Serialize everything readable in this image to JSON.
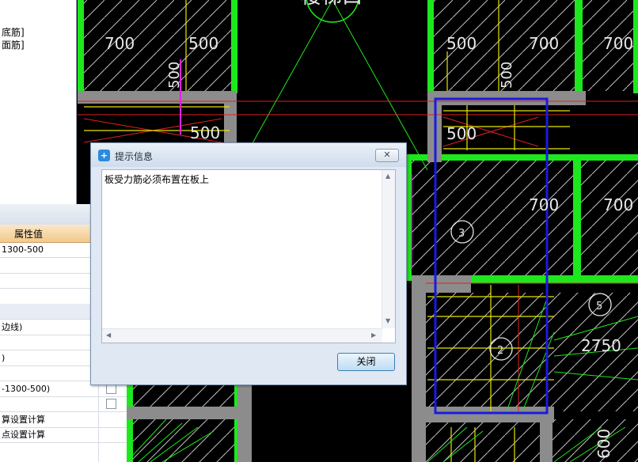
{
  "left_panel": {
    "items": [
      "底筋]",
      "面筋]"
    ]
  },
  "property_panel": {
    "header": "属性值",
    "rows": [
      {
        "value": "1300-500",
        "checkbox": false
      },
      {
        "value": "",
        "checkbox": false
      },
      {
        "value": "",
        "checkbox": false
      },
      {
        "value": "",
        "checkbox": false
      },
      {
        "value": "",
        "checkbox": false,
        "section": true
      },
      {
        "value": "边线)",
        "checkbox": false
      },
      {
        "value": "",
        "checkbox": false
      },
      {
        "value": ")",
        "checkbox": false
      },
      {
        "value": "",
        "checkbox": false
      },
      {
        "value": "-1300-500)",
        "checkbox": true
      },
      {
        "value": "",
        "checkbox": true
      },
      {
        "value": "算设置计算",
        "checkbox": false
      },
      {
        "value": "点设置计算",
        "checkbox": false
      }
    ]
  },
  "drawing": {
    "dimensions": [
      "700",
      "500",
      "500",
      "700",
      "700",
      "500",
      "500",
      "500",
      "700",
      "700",
      "2750",
      "600"
    ],
    "markers": [
      "3",
      "5",
      "2"
    ],
    "partial_label": "楼梯口"
  },
  "dialog": {
    "title": "提示信息",
    "message": "板受力筋必须布置在板上",
    "close_button": "关闭",
    "close_x": "✕"
  },
  "colors": {
    "wall_green": "#1de81d",
    "beam_gray": "#8c8c8c",
    "highlight_blue": "#1a1ae0",
    "yellow": "#e6e600",
    "red": "#e02020",
    "magenta": "#e020e0"
  }
}
